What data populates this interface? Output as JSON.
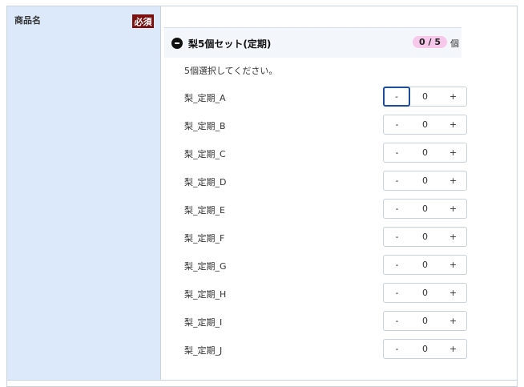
{
  "field": {
    "label": "商品名",
    "required_badge": "必須"
  },
  "set": {
    "title": "梨5個セット(定期)",
    "count": "0 / 5",
    "unit": "個",
    "instruction": "5個選択してください。"
  },
  "stepper": {
    "minus_label": "-",
    "plus_label": "+"
  },
  "items": [
    {
      "label": "梨_定期_A",
      "quantity": "0"
    },
    {
      "label": "梨_定期_B",
      "quantity": "0"
    },
    {
      "label": "梨_定期_C",
      "quantity": "0"
    },
    {
      "label": "梨_定期_D",
      "quantity": "0"
    },
    {
      "label": "梨_定期_E",
      "quantity": "0"
    },
    {
      "label": "梨_定期_F",
      "quantity": "0"
    },
    {
      "label": "梨_定期_G",
      "quantity": "0"
    },
    {
      "label": "梨_定期_H",
      "quantity": "0"
    },
    {
      "label": "梨_定期_I",
      "quantity": "0"
    },
    {
      "label": "梨_定期_J",
      "quantity": "0"
    }
  ],
  "colors": {
    "label_bg": "#dbe9fb",
    "badge_bg": "#7a1010",
    "count_pill_bg": "#f7c8ea",
    "focus_border": "#1b4d9a"
  }
}
